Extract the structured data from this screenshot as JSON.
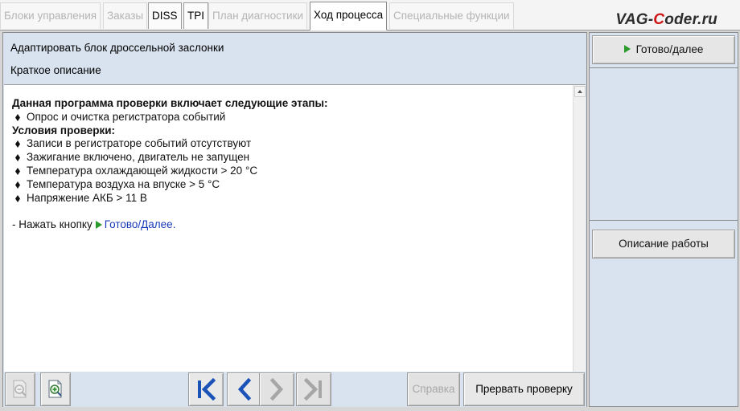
{
  "tabs": [
    {
      "label": "Блоки управления",
      "state": "disabled"
    },
    {
      "label": "Заказы",
      "state": "disabled"
    },
    {
      "label": "DISS",
      "state": "enabled"
    },
    {
      "label": "TPI",
      "state": "enabled"
    },
    {
      "label": "План диагностики",
      "state": "disabled"
    },
    {
      "label": "Ход процесса",
      "state": "active"
    },
    {
      "label": "Специальные функции",
      "state": "disabled"
    }
  ],
  "logo": {
    "part1": "VAG-",
    "part2": "C",
    "part3": "oder.ru"
  },
  "header": {
    "title": "Адаптировать блок дроссельной заслонки",
    "subtitle": "Краткое описание"
  },
  "content": {
    "heading1": "Данная программа проверки включает следующие этапы:",
    "steps": [
      "Опрос и очистка регистратора событий"
    ],
    "heading2": "Условия проверки:",
    "conditions": [
      "Записи в регистраторе событий отсутствуют",
      "Зажигание включено, двигатель не запущен",
      "Температура охлаждающей жидкости > 20 °C",
      "Температура воздуха на впуске > 5 °C",
      "Напряжение АКБ > 11 В"
    ],
    "instruction_prefix": "- Нажать кнопку",
    "instruction_link": "Готово/Далее",
    "instruction_suffix": "."
  },
  "right_panel": {
    "next_button": "Готово/далее",
    "description_button": "Описание работы"
  },
  "bottom_bar": {
    "help_button": "Справка",
    "abort_button": "Прервать проверку"
  },
  "icons": {
    "zoom_out": "zoom-out-icon",
    "zoom_in": "zoom-in-icon",
    "first": "skip-first-icon",
    "back": "chevron-left-icon",
    "forward": "chevron-right-icon",
    "last": "skip-last-icon",
    "play": "play-icon",
    "bullet": "diamond-bullet-icon"
  },
  "colors": {
    "panel": "#d8e3ef",
    "nav_blue": "#1a52b8",
    "play_green": "#2a9a2a",
    "link_blue": "#1a3bb8"
  }
}
